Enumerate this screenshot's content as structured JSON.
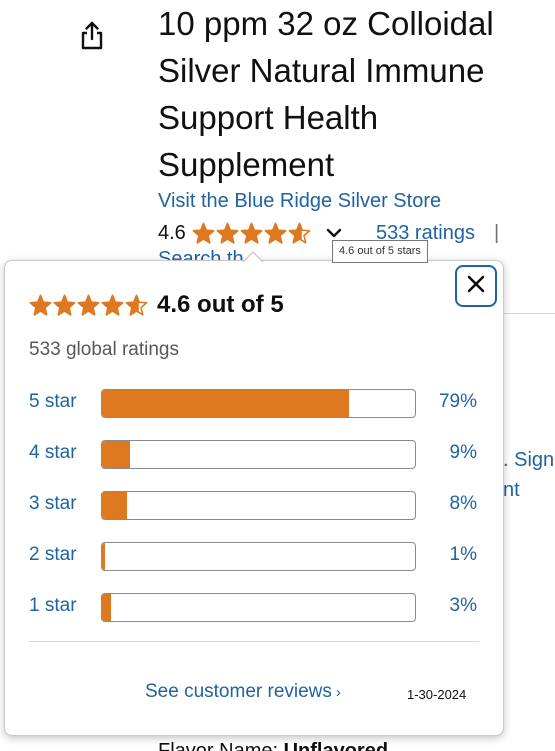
{
  "product": {
    "title": "10 ppm 32 oz Colloidal Silver Natural Immune Support Health Supplement",
    "store_link": "Visit the Blue Ridge Silver Store",
    "rating_value": "4.6",
    "rating_stars": 4.6,
    "ratings_link": "533 ratings",
    "pipe": "|",
    "under_link_partial": "Search th",
    "bottom_label": "Flavor Name:",
    "bottom_value": "Unflavored"
  },
  "tooltip": {
    "text": "4.6 out of 5 stars"
  },
  "background_side": {
    "sign_text": ". Sign",
    "nt_text": "nt"
  },
  "popover": {
    "summary": "4.6 out of 5",
    "summary_stars": 4.6,
    "global_ratings": "533 global ratings",
    "histogram": [
      {
        "label": "5 star",
        "percent_text": "79%",
        "percent": 79
      },
      {
        "label": "4 star",
        "percent_text": "9%",
        "percent": 9
      },
      {
        "label": "3 star",
        "percent_text": "8%",
        "percent": 8
      },
      {
        "label": "2 star",
        "percent_text": "1%",
        "percent": 1
      },
      {
        "label": "1 star",
        "percent_text": "3%",
        "percent": 3
      }
    ],
    "see_reviews": "See customer reviews",
    "see_reviews_caret": "›",
    "date": "1-30-2024",
    "close_icon": "close-icon"
  },
  "colors": {
    "star": "#de7921",
    "link": "#2162a1",
    "bar_fill": "#de7921",
    "close_border": "#2162a1"
  }
}
